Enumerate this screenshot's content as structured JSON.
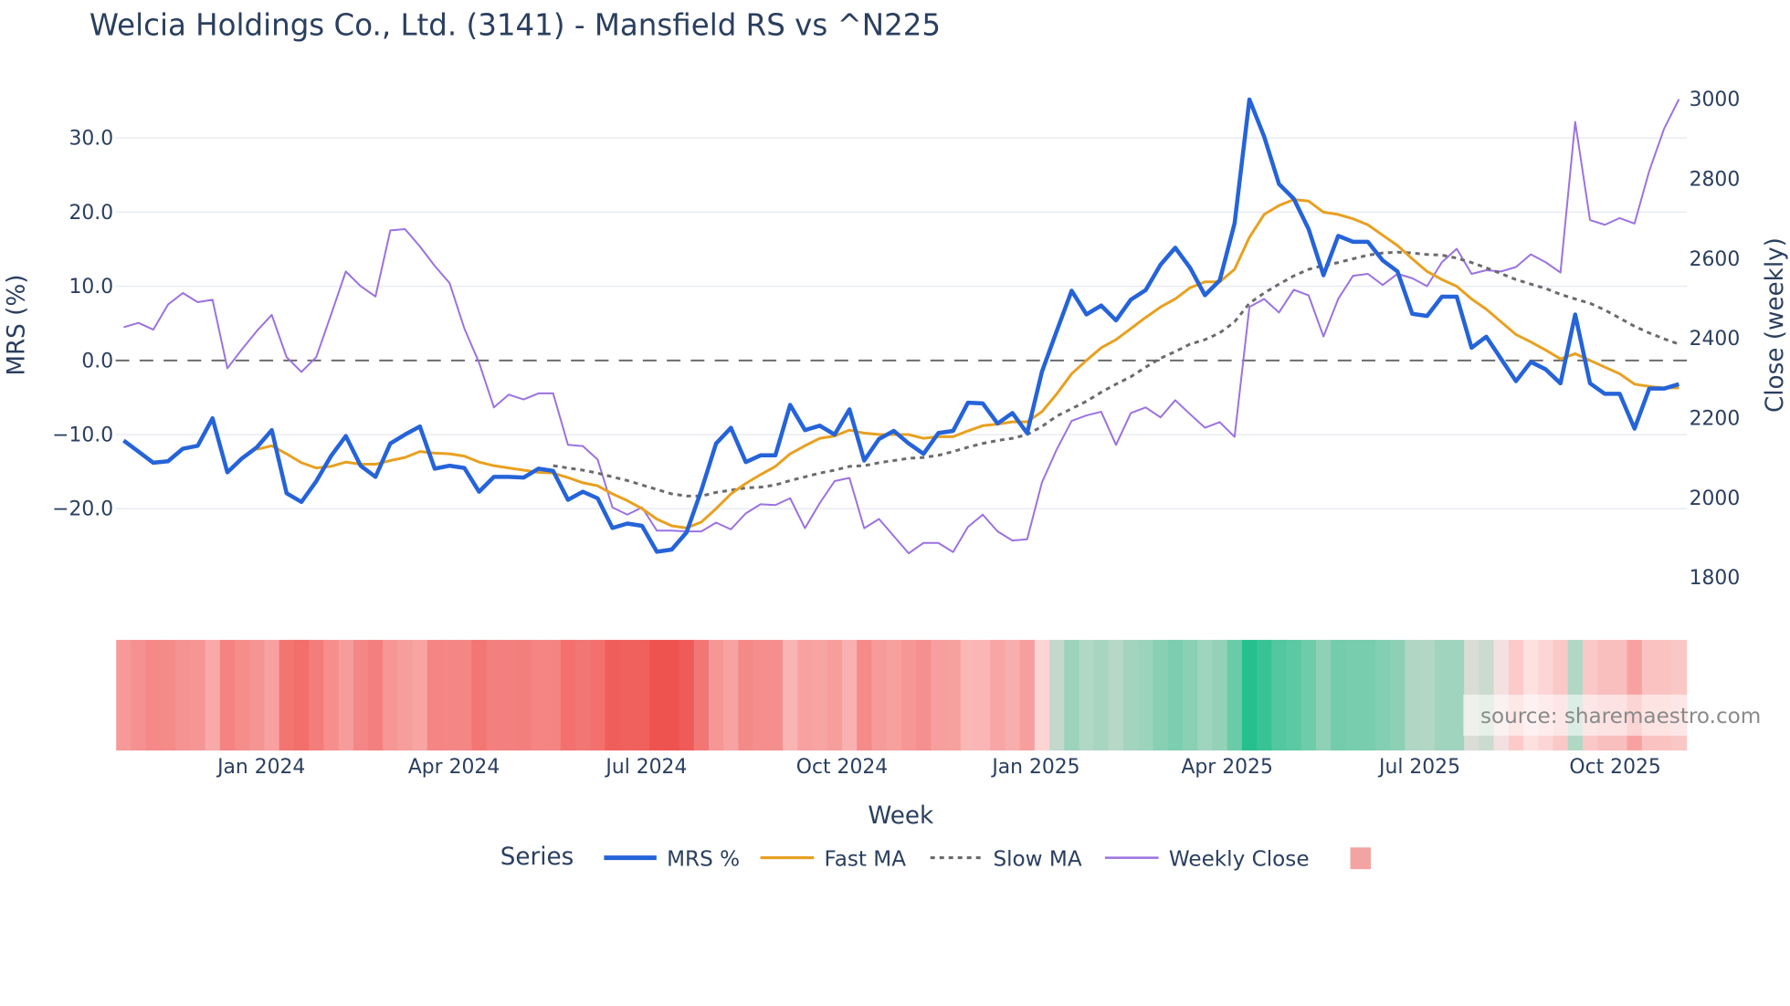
{
  "chart_data": {
    "type": "line",
    "title": "Welcia Holdings Co., Ltd. (3141) - Mansfield RS vs ^N225",
    "xlabel": "Week",
    "ylabel": "MRS (%)",
    "y2label": "Close (weekly)",
    "ylim": [
      -28.5,
      40.5
    ],
    "y2lim": [
      1800,
      3000
    ],
    "yticks": [
      "30.0",
      "20.0",
      "10.0",
      "0.0",
      "−10.0",
      "−20.0"
    ],
    "ytick_values": [
      30,
      20,
      10,
      0,
      -10,
      -20
    ],
    "y2ticks": [
      "3000",
      "2800",
      "2600",
      "2400",
      "2200",
      "2000",
      "1800"
    ],
    "y2tick_values": [
      3000,
      2800,
      2600,
      2400,
      2200,
      2000,
      1800
    ],
    "xticks": [
      "Jan 2024",
      "Apr 2024",
      "Jul 2024",
      "Oct 2024",
      "Jan 2025",
      "Apr 2025",
      "Jul 2025",
      "Oct 2025"
    ],
    "xtick_week_index": [
      9.3,
      22.3,
      35.3,
      48.5,
      61.6,
      74.5,
      87.5,
      100.7
    ],
    "grid": true,
    "zero_line": "dashed",
    "legend": {
      "title": "Series",
      "position": "bottom-center"
    },
    "series": [
      {
        "name": "MRS %",
        "axis": "left",
        "color": "#2563d9",
        "start_index": 0,
        "values": [
          -10.8,
          -12.3,
          -13.8,
          -13.6,
          -11.9,
          -11.5,
          -7.8,
          -15.1,
          -13.2,
          -11.7,
          -9.4,
          -17.9,
          -19.1,
          -16.3,
          -12.9,
          -10.2,
          -14.2,
          -15.7,
          -11.2,
          -10,
          -8.9,
          -14.6,
          -14.2,
          -14.5,
          -17.7,
          -15.7,
          -15.7,
          -15.8,
          -14.6,
          -14.9,
          -18.8,
          -17.7,
          -18.6,
          -22.6,
          -22,
          -22.3,
          -25.8,
          -25.5,
          -23.2,
          -17.5,
          -11.2,
          -9.1,
          -13.7,
          -12.8,
          -12.8,
          -6,
          -9.4,
          -8.8,
          -10,
          -6.6,
          -13.5,
          -10.6,
          -9.5,
          -11.2,
          -12.6,
          -9.8,
          -9.5,
          -5.7,
          -5.8,
          -8.5,
          -7.1,
          -9.8,
          -1.5,
          4,
          9.4,
          6.2,
          7.4,
          5.4,
          8.2,
          9.5,
          12.9,
          15.2,
          12.5,
          8.8,
          10.8,
          18.5,
          35.2,
          30.2,
          23.8,
          21.8,
          17.7,
          11.5,
          16.8,
          16,
          16,
          13.5,
          12,
          6.3,
          6,
          8.6,
          8.6,
          1.7,
          3.2,
          0.2,
          -2.8,
          -0.2,
          -1.2,
          -3.1,
          6.2,
          -3.1,
          -4.5,
          -4.5,
          -9.2,
          -3.8,
          -3.8,
          -3.2
        ]
      },
      {
        "name": "Fast MA",
        "axis": "left",
        "color": "#e8a020",
        "start_index": 9,
        "values": [
          -12,
          -11.5,
          -12.6,
          -13.8,
          -14.5,
          -14.3,
          -13.7,
          -14,
          -14,
          -13.5,
          -13.1,
          -12.3,
          -12.5,
          -12.6,
          -12.9,
          -13.7,
          -14.2,
          -14.5,
          -14.8,
          -15.1,
          -15.2,
          -15.8,
          -16.5,
          -16.9,
          -18,
          -18.9,
          -20,
          -21.4,
          -22.3,
          -22.6,
          -21.8,
          -20,
          -18,
          -16.6,
          -15.4,
          -14.3,
          -12.6,
          -11.5,
          -10.5,
          -10.2,
          -9.4,
          -9.8,
          -10,
          -10,
          -10,
          -10.5,
          -10.3,
          -10.3,
          -9.5,
          -8.8,
          -8.6,
          -8.3,
          -8.3,
          -6.9,
          -4.5,
          -1.8,
          0,
          1.7,
          2.8,
          4.3,
          5.8,
          7.2,
          8.3,
          9.8,
          10.6,
          10.6,
          12.3,
          16.6,
          19.7,
          20.9,
          21.7,
          21.5,
          20,
          19.7,
          19.1,
          18.3,
          16.9,
          15.5,
          13.7,
          12,
          10.9,
          10,
          8.3,
          6.9,
          5.2,
          3.5,
          2.5,
          1.4,
          0.2,
          0.9,
          0,
          -0.9,
          -1.8,
          -3.2,
          -3.5,
          -3.7,
          -3.7
        ]
      },
      {
        "name": "Slow MA",
        "axis": "left",
        "color": "#6b6b6b",
        "dash": "dot",
        "start_index": 29,
        "values": [
          -14.2,
          -14.5,
          -14.8,
          -15.2,
          -15.7,
          -16.2,
          -16.8,
          -17.4,
          -18,
          -18.3,
          -18.3,
          -17.8,
          -17.5,
          -17.2,
          -17.1,
          -16.8,
          -16.2,
          -15.7,
          -15.2,
          -14.8,
          -14.3,
          -14.2,
          -13.8,
          -13.5,
          -13.2,
          -13.1,
          -12.8,
          -12.3,
          -11.7,
          -11.2,
          -10.8,
          -10.5,
          -10,
          -8.9,
          -7.5,
          -6.5,
          -5.5,
          -4.3,
          -3.2,
          -2.2,
          -0.9,
          0.3,
          1.2,
          2.2,
          2.8,
          3.7,
          5.2,
          7.7,
          9.1,
          10.3,
          11.4,
          12.3,
          12.8,
          13.2,
          13.7,
          14.2,
          14.5,
          14.6,
          14.5,
          14.3,
          14.2,
          13.8,
          13.2,
          12.5,
          11.7,
          10.9,
          10.3,
          9.7,
          8.9,
          8.3,
          7.7,
          6.8,
          5.7,
          4.6,
          3.7,
          2.9,
          2.2
        ]
      },
      {
        "name": "Weekly Close",
        "axis": "right",
        "color": "#9b72e0",
        "start_index": 0,
        "values": [
          2428,
          2439,
          2422,
          2485,
          2514,
          2491,
          2497,
          2325,
          2373,
          2419,
          2459,
          2353,
          2316,
          2353,
          2459,
          2568,
          2531,
          2505,
          2671,
          2674,
          2631,
          2582,
          2539,
          2425,
          2339,
          2227,
          2259,
          2247,
          2262,
          2262,
          2133,
          2130,
          2096,
          1976,
          1958,
          1976,
          1918,
          1918,
          1916,
          1916,
          1938,
          1921,
          1961,
          1984,
          1982,
          1999,
          1924,
          1987,
          2042,
          2050,
          1924,
          1947,
          1904,
          1861,
          1887,
          1887,
          1864,
          1927,
          1958,
          1916,
          1893,
          1896,
          2039,
          2122,
          2193,
          2207,
          2216,
          2133,
          2213,
          2227,
          2202,
          2245,
          2210,
          2176,
          2190,
          2153,
          2479,
          2499,
          2465,
          2522,
          2508,
          2405,
          2499,
          2557,
          2562,
          2534,
          2562,
          2551,
          2531,
          2591,
          2625,
          2562,
          2571,
          2568,
          2579,
          2611,
          2591,
          2565,
          2943,
          2697,
          2685,
          2702,
          2688,
          2820,
          2926,
          3000
        ]
      }
    ],
    "heatmap": {
      "name": "",
      "based_on": "MRS %",
      "colorscale": {
        "min": -25,
        "mid": 0,
        "max": 35,
        "min_color": "#ef5350",
        "mid_color": "#fde3e3",
        "max_color": "#26c08e"
      },
      "legend_color": "#f4a3a3"
    }
  },
  "watermark": "source: sharemaestro.com"
}
